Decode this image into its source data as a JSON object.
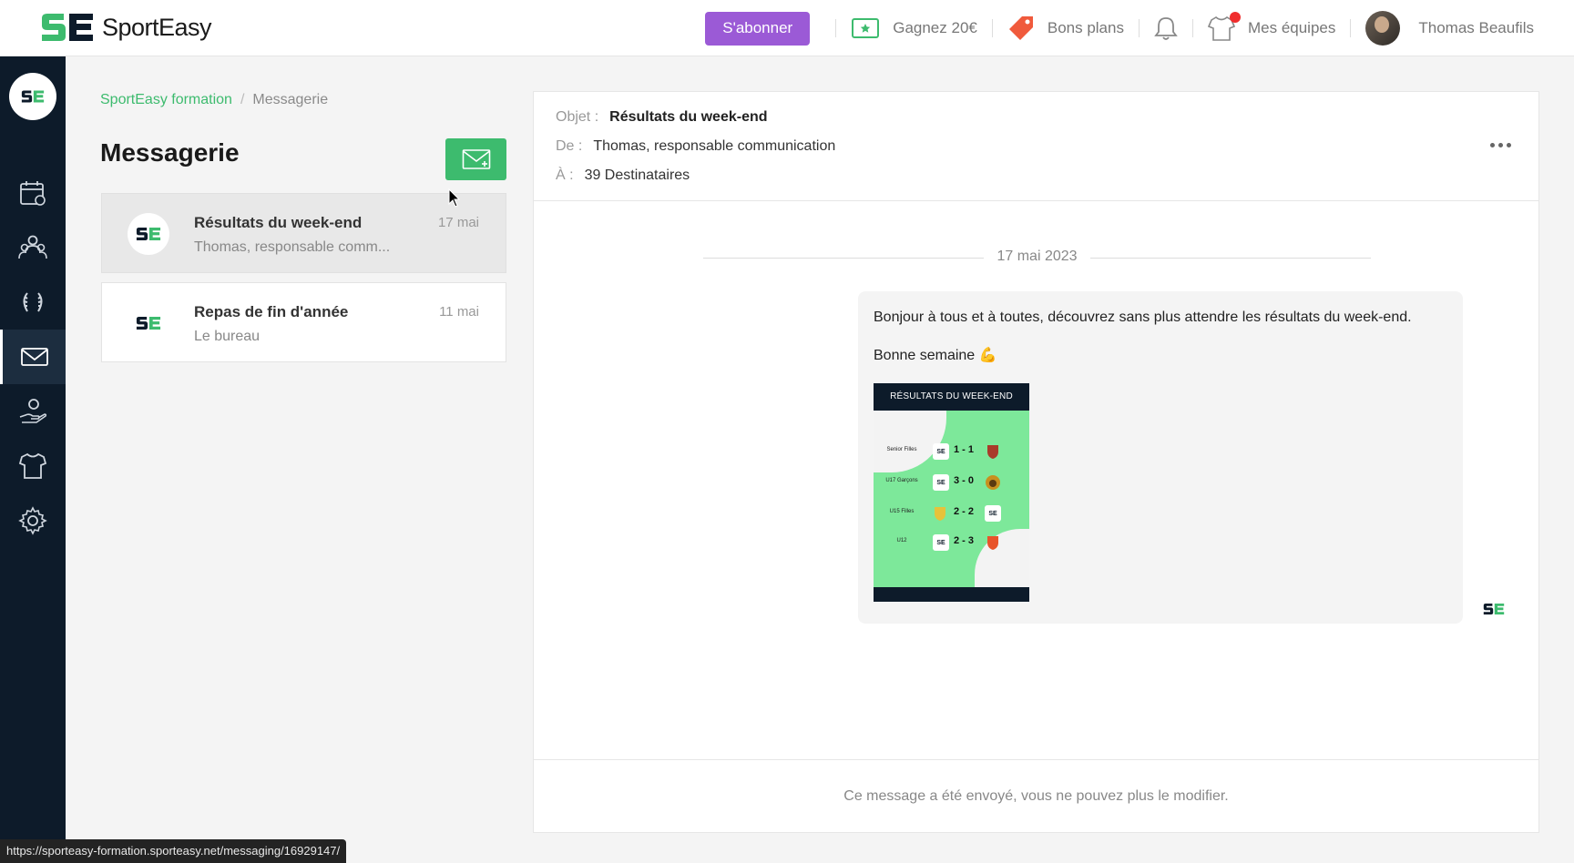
{
  "app": {
    "name": "SportEasy",
    "colors": {
      "brand_green": "#3dbb6e",
      "accent_purple": "#9b5ad6",
      "sidebar_bg": "#0d1b2a"
    }
  },
  "topbar": {
    "subscribe_label": "S'abonner",
    "earn_label": "Gagnez 20€",
    "deals_label": "Bons plans",
    "teams_label": "Mes équipes",
    "user_name": "Thomas Beaufils"
  },
  "sidebar": {
    "items": [
      {
        "name": "calendar",
        "icon": "calendar-icon"
      },
      {
        "name": "members",
        "icon": "users-icon"
      },
      {
        "name": "competitions",
        "icon": "laurel-icon"
      },
      {
        "name": "messaging",
        "icon": "mail-icon",
        "active": true
      },
      {
        "name": "contributions",
        "icon": "hand-coin-icon"
      },
      {
        "name": "jerseys",
        "icon": "jersey-icon"
      },
      {
        "name": "settings",
        "icon": "gear-icon"
      }
    ]
  },
  "breadcrumb": {
    "parent": "SportEasy formation",
    "separator": "/",
    "current": "Messagerie"
  },
  "messaging": {
    "title": "Messagerie",
    "conversations": [
      {
        "subject": "Résultats du week-end",
        "preview": "Thomas, responsable comm...",
        "date": "17 mai",
        "selected": true
      },
      {
        "subject": "Repas de fin d'année",
        "preview": "Le bureau",
        "date": "11 mai",
        "selected": false
      }
    ]
  },
  "message": {
    "subject_label": "Objet :",
    "subject": "Résultats du week-end",
    "from_label": "De :",
    "from": "Thomas, responsable communication",
    "to_label": "À :",
    "to": "39 Destinataires",
    "date_divider": "17 mai 2023",
    "body_line1": "Bonjour à tous et à toutes, découvrez sans plus attendre les résultats du week-end.",
    "body_line2": "Bonne semaine 💪",
    "attachment": {
      "title": "RÉSULTATS DU WEEK-END",
      "results": [
        {
          "team": "Senior Filles",
          "score": "1 - 1"
        },
        {
          "team": "U17 Garçons",
          "score": "3 - 0"
        },
        {
          "team": "U15 Filles",
          "score": "2 - 2"
        },
        {
          "team": "U12",
          "score": "2 - 3"
        }
      ]
    },
    "footer_note": "Ce message a été envoyé, vous ne pouvez plus le modifier."
  },
  "status_bar": {
    "url": "https://sporteasy-formation.sporteasy.net/messaging/16929147/"
  }
}
